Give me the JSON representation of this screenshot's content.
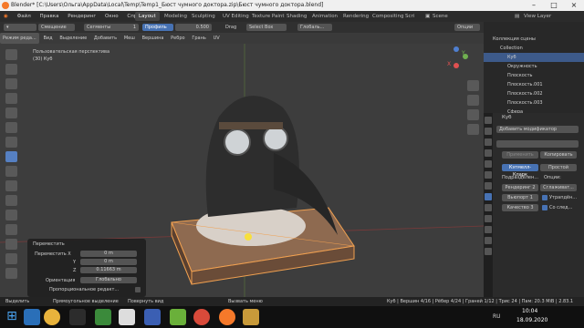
{
  "window": {
    "title": "Blender* [C:\\Users\\Ольга\\AppData\\Local\\Temp\\Temp1_Бюст чумного доктора.zip\\Бюст чумного доктора.blend]"
  },
  "menu": [
    "Файл",
    "Правка",
    "Рендеринг",
    "Окно",
    "Справка"
  ],
  "workspaces": [
    "Layout",
    "Modeling",
    "Sculpting",
    "UV Editing",
    "Texture Paint",
    "Shading",
    "Animation",
    "Rendering",
    "Compositing",
    "Scri"
  ],
  "topright": {
    "scene": "Scene",
    "view_layer": "View Layer"
  },
  "tool_header": {
    "offset": "Смещение",
    "segments_label": "Сегменты",
    "segments_value": "1",
    "profile": "Профиль",
    "amount": "0.500",
    "drag": "Drag",
    "select_box": "Select Box",
    "global": "Глобаль...",
    "options": "Опции"
  },
  "viewport_header": {
    "mode": "Режим реда...",
    "items": [
      "Вид",
      "Выделение",
      "Добавить",
      "Меш",
      "Вершина",
      "Ребро",
      "Грань",
      "UV"
    ]
  },
  "viewport": {
    "persp": "Пользовательская перспектива",
    "object": "(30) Куб"
  },
  "operator": {
    "title": "Переместить",
    "x_label": "Переместить X",
    "x_value": "0 m",
    "y_label": "Y",
    "y_value": "0 m",
    "z_label": "Z",
    "z_value": "0.11663 m",
    "orient_label": "Ориентация",
    "orient_value": "Глобально",
    "prop_edit": "Пропорциональное редакт..."
  },
  "status": {
    "select": "Выделить",
    "box": "Прямоугольное выделение",
    "rotate": "Повернуть вид",
    "menu": "Вызвать меню",
    "stats": "Куб | Вершин 4/16 | Рёбер 4/24 | Граней 1/12 | Трис 24 | Пам: 20.3 MiB | 2.83.1"
  },
  "outliner": {
    "header": "Коллекция сцены",
    "items": [
      "Collection",
      "Куб",
      "Окружность",
      "Плоскость",
      "Плоскость.001",
      "Плоскость.002",
      "Плоскость.003",
      "Сфера"
    ]
  },
  "properties": {
    "object": "Куб",
    "add_modifier": "Добавить модификатор",
    "apply": "Применить",
    "copy": "Копировать",
    "kutmull": "Кэтмелл-Кларк",
    "simple": "Простой",
    "subdiv_label": "Подразделен...",
    "options_label": "Опции:",
    "render_label": "Рендеринг",
    "render_val": "2",
    "viewport_label": "Вьюпорт",
    "viewport_val": "1",
    "quality_label": "Качество",
    "quality_val": "3",
    "smooth": "Сглаживат...",
    "opt1": "Утрапдён...",
    "opt2": "Со след..."
  },
  "taskbar": {
    "lang": "RU",
    "time": "10:04",
    "date": "18.09.2020"
  }
}
